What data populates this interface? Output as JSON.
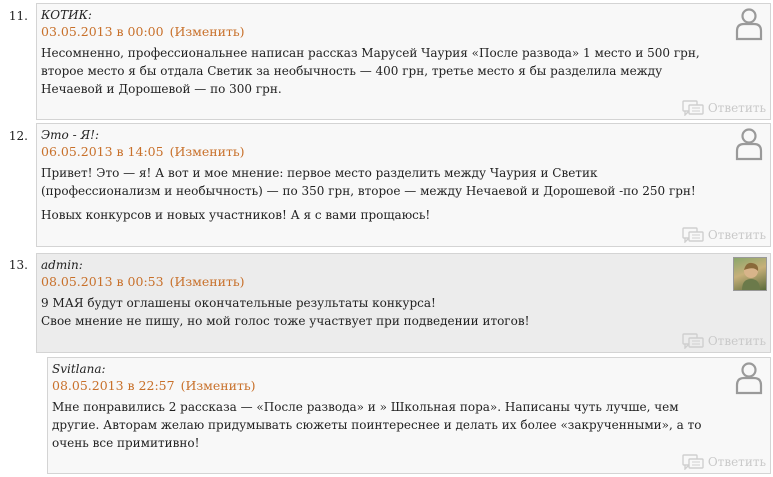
{
  "reply_label": "Ответить",
  "edit_label": "(Изменить)",
  "comments": [
    {
      "number": "11.",
      "author": "КОТИК:",
      "date": "03.05.2013 в 00:00",
      "paragraphs": [
        "Несомненно, профессиональнее написан рассказ Марусей Чаурия «После развода» 1 место и 500 грн, второе место я бы отдала Светик за необычность — 400 грн, третье место я бы разделила между Нечаевой и Дорошевой — по 300 грн."
      ]
    },
    {
      "number": "12.",
      "author": "Это - Я!:",
      "date": "06.05.2013 в 14:05",
      "paragraphs": [
        "Привет! Это — я! А вот и мое мнение: первое место разделить между Чаурия и Светик (профессионализм и необычность) — по 350 грн, второе — между Нечаевой и Дорошевой -по 250 грн!",
        "Новых конкурсов и новых участников! А я с вами прощаюсь!"
      ]
    },
    {
      "number": "13.",
      "author": "admin:",
      "date": "08.05.2013 в 00:53",
      "paragraphs": [
        "9 МАЯ будут оглашены окончательные результаты конкурса!",
        "Свое мнение не пишу, но мой голос тоже участвует при подведении итогов!"
      ]
    },
    {
      "author": "Svitlana:",
      "date": "08.05.2013 в 22:57",
      "paragraphs": [
        "Мне понравились 2 рассказа — «После развода» и » Школьная пора». Написаны чуть лучше, чем другие. Авторам желаю придумывать сюжеты поинтереснее и делать их более «закрученными», а то очень все примитивно!"
      ]
    }
  ]
}
